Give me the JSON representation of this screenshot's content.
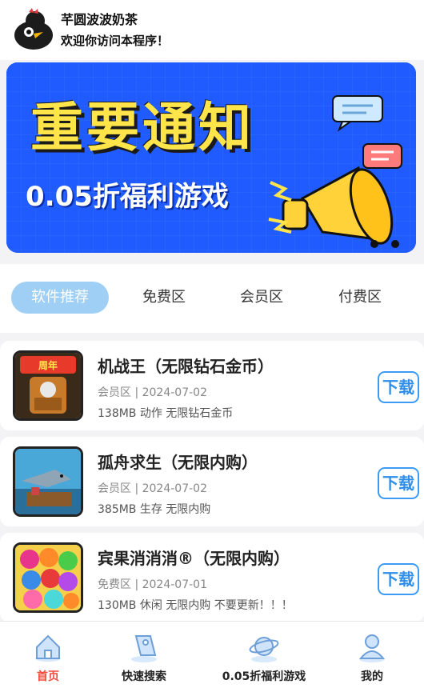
{
  "header": {
    "app_name": "芊圆波波奶茶",
    "welcome": "欢迎你访问本程序！",
    "avatar_icon": "chick-avatar-icon"
  },
  "banner": {
    "title": "重要通知",
    "subtitle": "0.05折福利游戏"
  },
  "tabs": [
    {
      "label": "软件推荐",
      "active": true
    },
    {
      "label": "免费区",
      "active": false
    },
    {
      "label": "会员区",
      "active": false
    },
    {
      "label": "付费区",
      "active": false
    }
  ],
  "apps": [
    {
      "title": "机战王（无限钻石金币）",
      "meta": "会员区 | 2024-07-02",
      "desc": "138MB 动作 无限钻石金币",
      "button": "下载"
    },
    {
      "title": "孤舟求生（无限内购）",
      "meta": "会员区 | 2024-07-02",
      "desc": "385MB 生存 无限内购",
      "button": "下载"
    },
    {
      "title": "宾果消消消®（无限内购）",
      "meta": "免费区 | 2024-07-01",
      "desc": "130MB 休闲 无限内购 不要更新！！！",
      "button": "下载"
    }
  ],
  "nav": [
    {
      "label": "首页",
      "icon": "home-icon",
      "active": true
    },
    {
      "label": "快速搜索",
      "icon": "search-tag-icon",
      "active": false
    },
    {
      "label": "0.05折福利游戏",
      "icon": "planet-icon",
      "active": false
    },
    {
      "label": "我的",
      "icon": "profile-icon",
      "active": false
    }
  ],
  "colors": {
    "banner_bg": "#1f5bff",
    "banner_title": "#ffe54a",
    "tab_active": "#9fcff4",
    "download_border": "#3b9cf2",
    "nav_active": "#f04a3a"
  }
}
